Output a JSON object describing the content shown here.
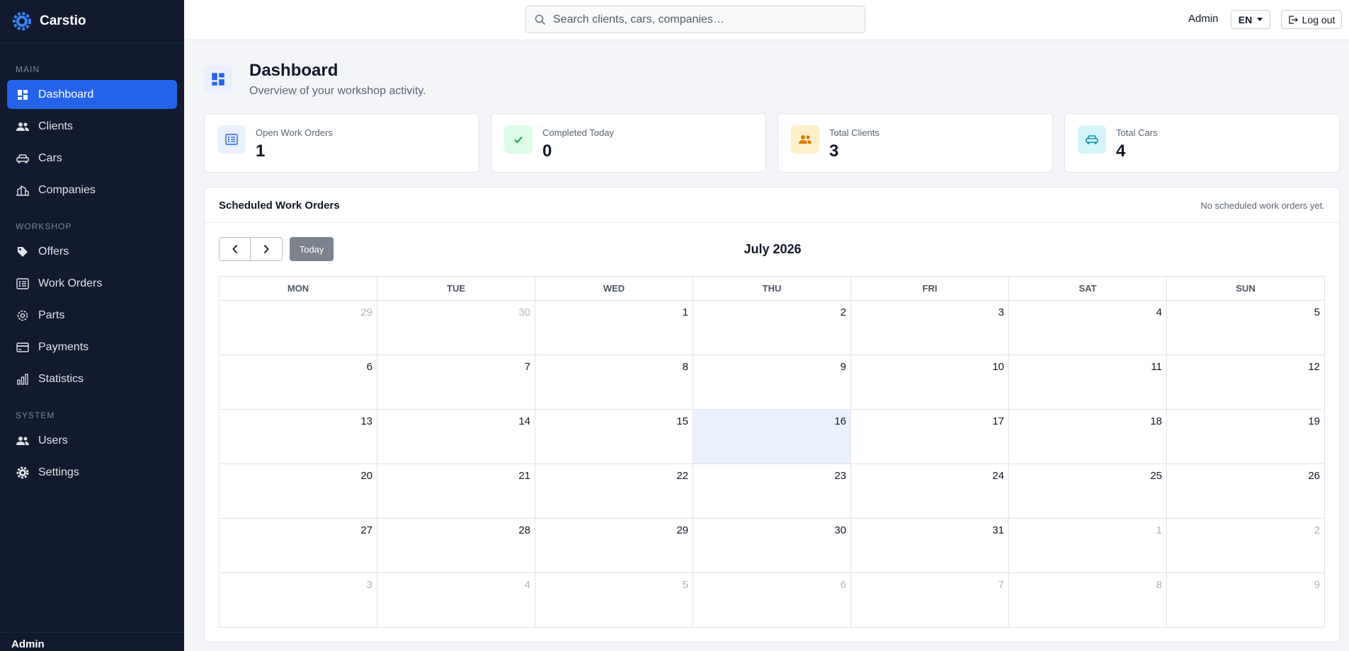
{
  "app": {
    "name": "Carstio"
  },
  "sidebar": {
    "sections": [
      {
        "title": "MAIN",
        "items": [
          {
            "label": "Dashboard",
            "icon": "dashboard-icon",
            "active": true
          },
          {
            "label": "Clients",
            "icon": "users-icon"
          },
          {
            "label": "Cars",
            "icon": "car-icon"
          },
          {
            "label": "Companies",
            "icon": "building-icon"
          }
        ]
      },
      {
        "title": "WORKSHOP",
        "items": [
          {
            "label": "Offers",
            "icon": "tag-icon"
          },
          {
            "label": "Work Orders",
            "icon": "list-icon"
          },
          {
            "label": "Parts",
            "icon": "gear-outline-icon"
          },
          {
            "label": "Payments",
            "icon": "credit-card-icon"
          },
          {
            "label": "Statistics",
            "icon": "bar-chart-icon"
          }
        ]
      },
      {
        "title": "SYSTEM",
        "items": [
          {
            "label": "Users",
            "icon": "users-icon"
          },
          {
            "label": "Settings",
            "icon": "gear-icon"
          }
        ]
      }
    ],
    "footer_user": "Admin"
  },
  "topbar": {
    "search_placeholder": "Search clients, cars, companies…",
    "user_name": "Admin",
    "language": "EN",
    "logout_label": "Log out"
  },
  "page": {
    "title": "Dashboard",
    "subtitle": "Overview of your workshop activity."
  },
  "stats": [
    {
      "label": "Open Work Orders",
      "value": "1",
      "icon": "list-icon",
      "color": "#2563eb",
      "bg": "#eaf0fd"
    },
    {
      "label": "Completed Today",
      "value": "0",
      "icon": "check-icon",
      "color": "#16a34a",
      "bg": "#dcfce7"
    },
    {
      "label": "Total Clients",
      "value": "3",
      "icon": "users-icon",
      "color": "#d97706",
      "bg": "#fdf0c8"
    },
    {
      "label": "Total Cars",
      "value": "4",
      "icon": "car-icon",
      "color": "#0891b2",
      "bg": "#d5f5fb"
    }
  ],
  "calendar": {
    "panel_title": "Scheduled Work Orders",
    "panel_note": "No scheduled work orders yet.",
    "today_label": "Today",
    "month_title": "July 2026",
    "weekdays": [
      "MON",
      "TUE",
      "WED",
      "THU",
      "FRI",
      "SAT",
      "SUN"
    ],
    "weeks": [
      [
        {
          "d": "29",
          "o": true
        },
        {
          "d": "30",
          "o": true
        },
        {
          "d": "1"
        },
        {
          "d": "2"
        },
        {
          "d": "3"
        },
        {
          "d": "4"
        },
        {
          "d": "5"
        }
      ],
      [
        {
          "d": "6"
        },
        {
          "d": "7"
        },
        {
          "d": "8"
        },
        {
          "d": "9"
        },
        {
          "d": "10"
        },
        {
          "d": "11"
        },
        {
          "d": "12"
        }
      ],
      [
        {
          "d": "13"
        },
        {
          "d": "14"
        },
        {
          "d": "15"
        },
        {
          "d": "16",
          "today": true
        },
        {
          "d": "17"
        },
        {
          "d": "18"
        },
        {
          "d": "19"
        }
      ],
      [
        {
          "d": "20"
        },
        {
          "d": "21"
        },
        {
          "d": "22"
        },
        {
          "d": "23"
        },
        {
          "d": "24"
        },
        {
          "d": "25"
        },
        {
          "d": "26"
        }
      ],
      [
        {
          "d": "27"
        },
        {
          "d": "28"
        },
        {
          "d": "29"
        },
        {
          "d": "30"
        },
        {
          "d": "31"
        },
        {
          "d": "1",
          "o": true
        },
        {
          "d": "2",
          "o": true
        }
      ],
      [
        {
          "d": "3",
          "o": true
        },
        {
          "d": "4",
          "o": true
        },
        {
          "d": "5",
          "o": true
        },
        {
          "d": "6",
          "o": true
        },
        {
          "d": "7",
          "o": true
        },
        {
          "d": "8",
          "o": true
        },
        {
          "d": "9",
          "o": true
        }
      ]
    ]
  }
}
